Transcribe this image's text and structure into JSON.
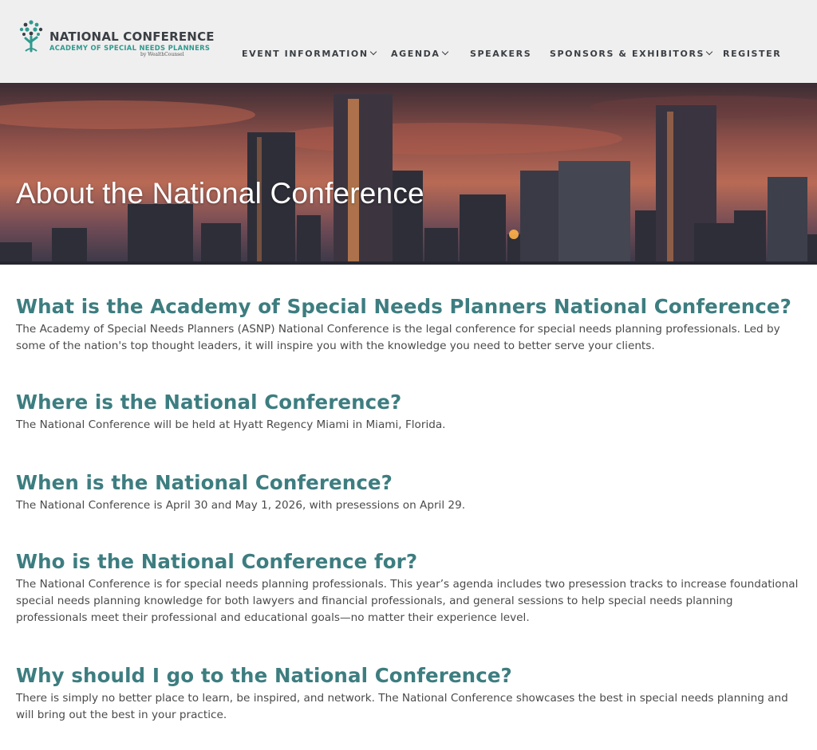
{
  "brand": {
    "title": "NATIONAL CONFERENCE",
    "subtitle": "ACADEMY OF SPECIAL NEEDS PLANNERS",
    "by_line": "by WealthCounsel",
    "accent_color": "#2f9a8f",
    "heading_color": "#3d7d80"
  },
  "nav": {
    "event_information": "EVENT INFORMATION",
    "agenda": "AGENDA",
    "speakers": "SPEAKERS",
    "sponsors_exhibitors": "SPONSORS & EXHIBITORS",
    "register": "REGISTER"
  },
  "hero": {
    "title": "About the National Conference"
  },
  "faq": [
    {
      "question": "What is the Academy of Special Needs Planners National Conference?",
      "answer": "The Academy of Special Needs Planners (ASNP) National Conference is the legal conference for special needs planning professionals. Led by some of the nation's top thought leaders, it will inspire you with the knowledge you need to better serve your clients."
    },
    {
      "question": "Where is the National Conference?",
      "answer": "The National Conference will be held at Hyatt Regency Miami in Miami, Florida."
    },
    {
      "question": "When is the National Conference?",
      "answer": "The National Conference is April 30 and May 1, 2026, with presessions on April 29."
    },
    {
      "question": "Who is the National Conference for?",
      "answer": "The National Conference is for special needs planning professionals. This year’s agenda includes two presession tracks to increase foundational special needs planning knowledge for both lawyers and financial professionals, and general sessions to help special needs planning professionals meet their professional and educational goals—no matter their experience level."
    },
    {
      "question": "Why should I go to the National Conference?",
      "answer": "There is simply no better place to learn, be inspired, and network. The National Conference showcases the best in special needs planning and will bring out the best in your practice."
    }
  ]
}
